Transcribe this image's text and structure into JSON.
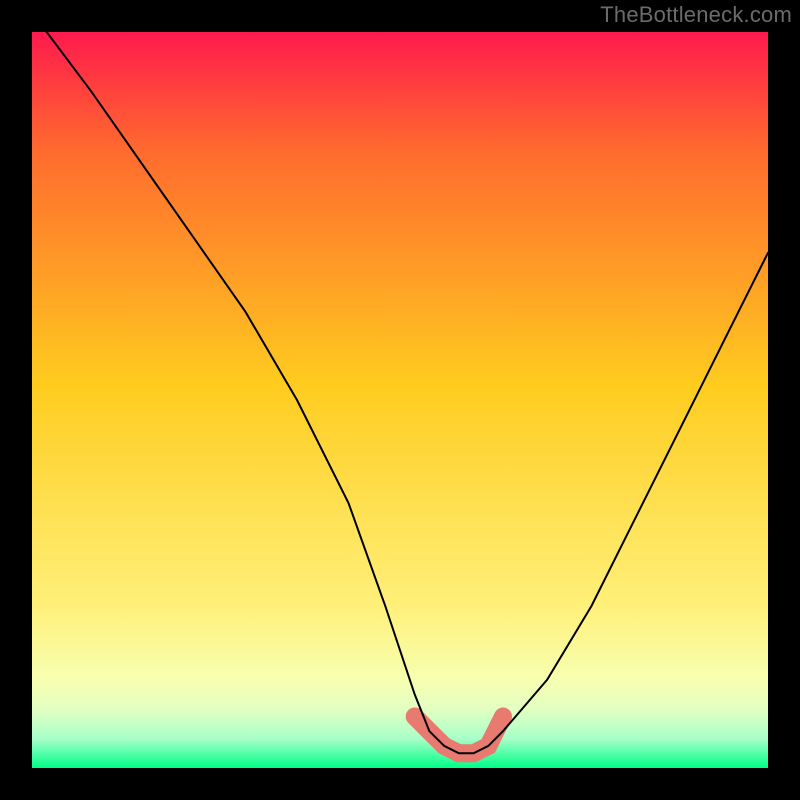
{
  "domain": "Chart",
  "header": {
    "watermark": "TheBottleneck.com"
  },
  "colors": {
    "frame_bg": "#000000",
    "gradient_top": "#ff1a4d",
    "gradient_mid_top": "#ff6a2e",
    "gradient_mid": "#ffcc1f",
    "gradient_mid_bottom": "#fff07a",
    "gradient_low1": "#f7ffb0",
    "gradient_low2": "#e3ffc2",
    "gradient_low3": "#a8ffc8",
    "gradient_bottom": "#00ff88",
    "curve_stroke": "#000000",
    "accent_stroke": "#e87a70",
    "watermark_text": "#6b6b6b"
  },
  "chart_data": {
    "type": "line",
    "title": "",
    "xlabel": "",
    "ylabel": "",
    "xlim": [
      0,
      100
    ],
    "ylim": [
      0,
      100
    ],
    "grid": false,
    "legend": false,
    "series": [
      {
        "name": "bottleneck-curve",
        "x": [
          2,
          8,
          15,
          22,
          29,
          36,
          43,
          48,
          52,
          54,
          56,
          58,
          60,
          62,
          64,
          70,
          76,
          82,
          88,
          94,
          100
        ],
        "y": [
          100,
          92,
          82,
          72,
          62,
          50,
          36,
          22,
          10,
          5,
          3,
          2,
          2,
          3,
          5,
          12,
          22,
          34,
          46,
          58,
          70
        ]
      }
    ],
    "accent_segment": {
      "name": "highlight-near-minimum",
      "x": [
        52,
        54,
        56,
        58,
        60,
        62,
        64
      ],
      "y": [
        7,
        5,
        3,
        2,
        2,
        3,
        7
      ]
    },
    "notes": "V-shaped curve on a vertical red-to-green gradient background. Minimum near x≈58-60. Pink/coral thick stroke highlights the valley floor. No axis ticks, labels, or legend rendered."
  }
}
